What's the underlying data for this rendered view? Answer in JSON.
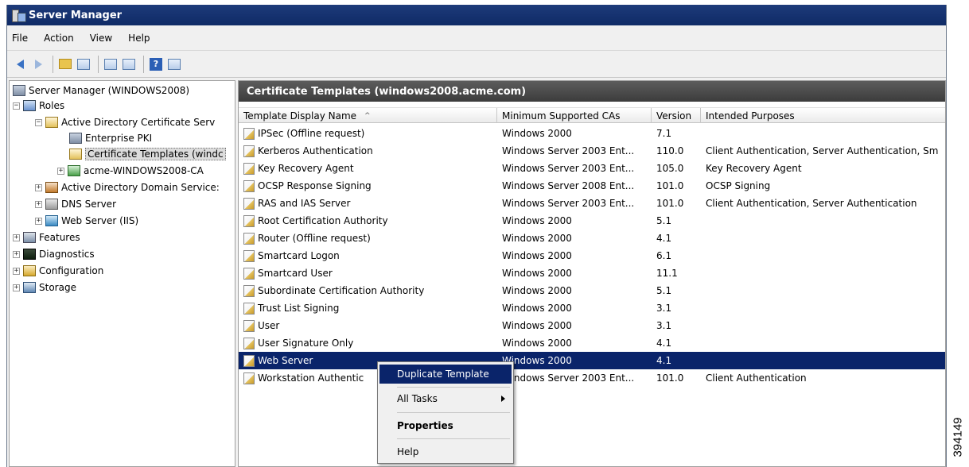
{
  "window": {
    "title": "Server Manager"
  },
  "menubar": {
    "items": [
      "File",
      "Action",
      "View",
      "Help"
    ]
  },
  "toolbar": {
    "buttons": [
      "back-arrow-icon",
      "forward-arrow-icon",
      "up-folder-icon",
      "show-hide-tree-icon",
      "export-list-icon",
      "refresh-icon",
      "help-icon",
      "properties-icon"
    ]
  },
  "tree": {
    "root": "Server Manager (WINDOWS2008)",
    "roles": "Roles",
    "adcs": "Active Directory Certificate Serv",
    "enterprise_pki": "Enterprise PKI",
    "cert_templates": "Certificate Templates (windc",
    "ca": "acme-WINDOWS2008-CA",
    "adds": "Active Directory Domain Service:",
    "dns": "DNS Server",
    "web": "Web Server (IIS)",
    "features": "Features",
    "diagnostics": "Diagnostics",
    "configuration": "Configuration",
    "storage": "Storage"
  },
  "pane": {
    "title": "Certificate Templates (windows2008.acme.com)"
  },
  "columns": {
    "name": "Template Display Name",
    "sort": "^",
    "min_ca": "Minimum Supported CAs",
    "version": "Version",
    "purposes": "Intended Purposes"
  },
  "rows": [
    {
      "name": "IPSec (Offline request)",
      "min_ca": "Windows 2000",
      "version": "7.1",
      "purposes": ""
    },
    {
      "name": "Kerberos Authentication",
      "min_ca": "Windows Server 2003 Ent...",
      "version": "110.0",
      "purposes": "Client Authentication, Server Authentication, Sm"
    },
    {
      "name": "Key Recovery Agent",
      "min_ca": "Windows Server 2003 Ent...",
      "version": "105.0",
      "purposes": "Key Recovery Agent"
    },
    {
      "name": "OCSP Response Signing",
      "min_ca": "Windows Server 2008 Ent...",
      "version": "101.0",
      "purposes": "OCSP Signing"
    },
    {
      "name": "RAS and IAS Server",
      "min_ca": "Windows Server 2003 Ent...",
      "version": "101.0",
      "purposes": "Client Authentication, Server Authentication"
    },
    {
      "name": "Root Certification Authority",
      "min_ca": "Windows 2000",
      "version": "5.1",
      "purposes": ""
    },
    {
      "name": "Router (Offline request)",
      "min_ca": "Windows 2000",
      "version": "4.1",
      "purposes": ""
    },
    {
      "name": "Smartcard Logon",
      "min_ca": "Windows 2000",
      "version": "6.1",
      "purposes": ""
    },
    {
      "name": "Smartcard User",
      "min_ca": "Windows 2000",
      "version": "11.1",
      "purposes": ""
    },
    {
      "name": "Subordinate Certification Authority",
      "min_ca": "Windows 2000",
      "version": "5.1",
      "purposes": ""
    },
    {
      "name": "Trust List Signing",
      "min_ca": "Windows 2000",
      "version": "3.1",
      "purposes": ""
    },
    {
      "name": "User",
      "min_ca": "Windows 2000",
      "version": "3.1",
      "purposes": ""
    },
    {
      "name": "User Signature Only",
      "min_ca": "Windows 2000",
      "version": "4.1",
      "purposes": ""
    },
    {
      "name": "Web Server",
      "min_ca": "Windows 2000",
      "version": "4.1",
      "purposes": "",
      "selected": true
    },
    {
      "name": "Workstation Authentic",
      "min_ca": "Windows Server 2003 Ent...",
      "version": "101.0",
      "purposes": "Client Authentication"
    }
  ],
  "context_menu": {
    "duplicate": "Duplicate Template",
    "all_tasks": "All Tasks",
    "properties": "Properties",
    "help": "Help"
  },
  "figure_id": "394149",
  "colors": {
    "title_bar": "#163270",
    "selection": "#0a246a",
    "pane_header": "#4a4a4a"
  }
}
